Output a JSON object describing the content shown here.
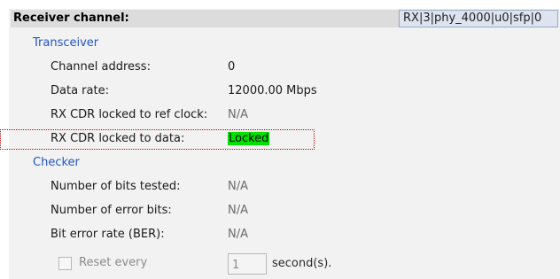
{
  "receiver": {
    "title": "Receiver channel:",
    "selected_channel": "RX|3|phy_4000|u0|sfp|0"
  },
  "transceiver": {
    "title": "Transceiver",
    "rows": [
      {
        "label": "Channel address:",
        "value": "0"
      },
      {
        "label": "Data rate:",
        "value": "12000.00 Mbps"
      },
      {
        "label": "RX CDR locked to ref clock:",
        "value": "N/A"
      },
      {
        "label": "RX CDR locked to data:",
        "value": "Locked"
      }
    ]
  },
  "checker": {
    "title": "Checker",
    "rows": [
      {
        "label": "Number of bits tested:",
        "value": "N/A"
      },
      {
        "label": "Number of error bits:",
        "value": "N/A"
      },
      {
        "label": "Bit error rate (BER):",
        "value": "N/A"
      }
    ]
  },
  "reset": {
    "label": "Reset every",
    "interval_value": "1",
    "unit": "second(s)."
  },
  "colors": {
    "section_title": "#1f56c7",
    "locked_status": "#00e000",
    "highlight_border": "#c00000"
  }
}
